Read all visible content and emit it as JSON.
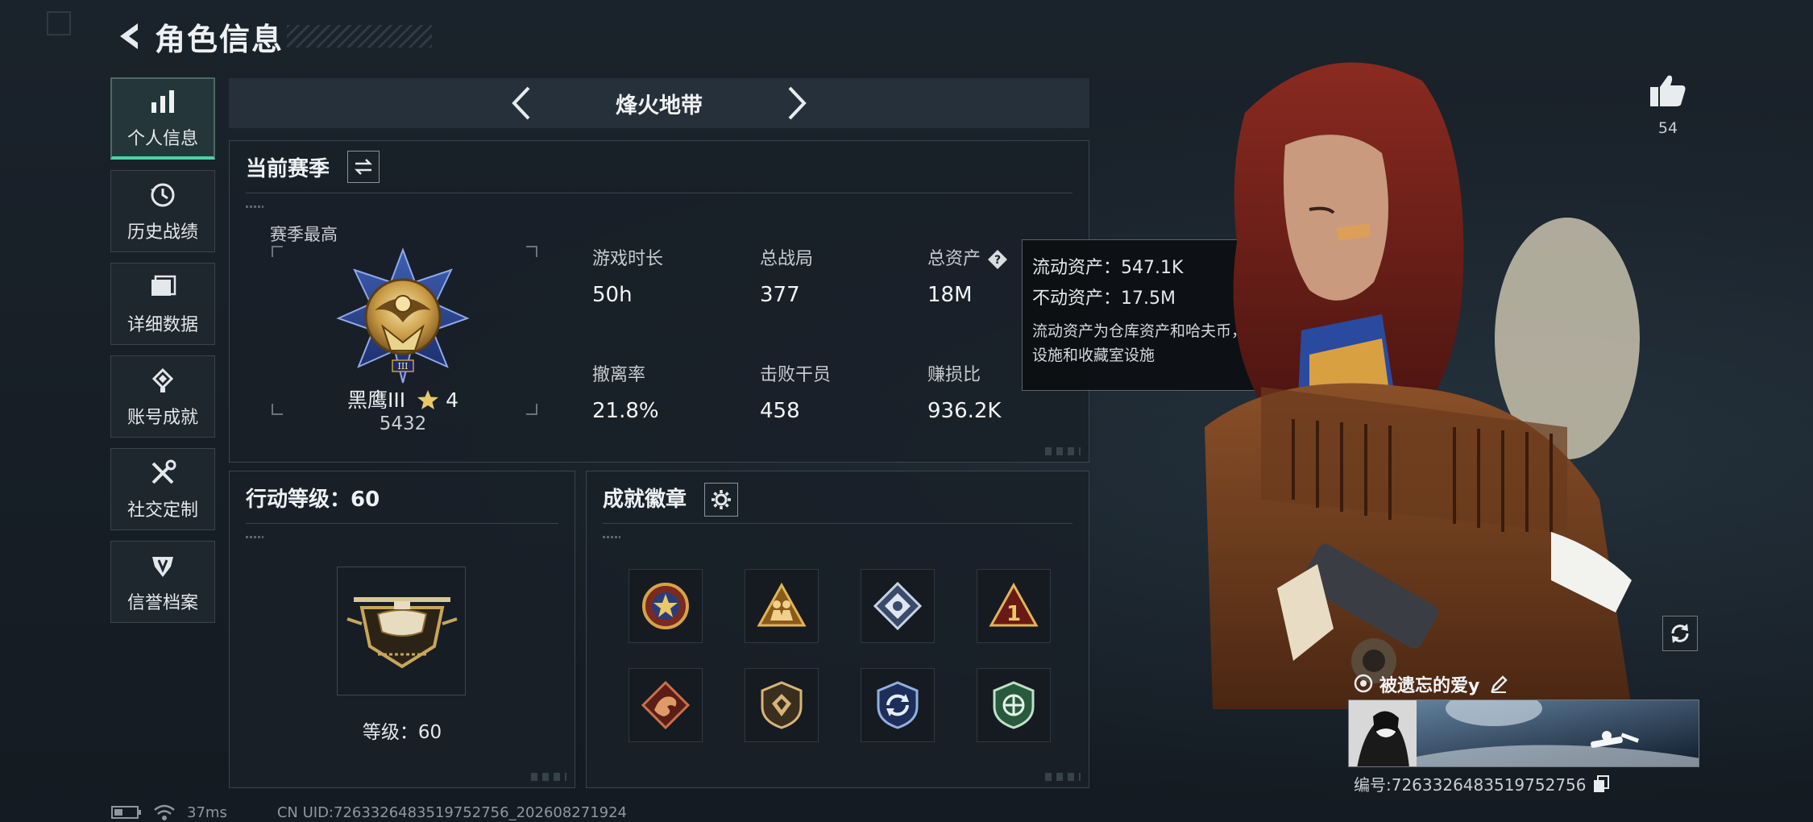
{
  "header": {
    "title": "角色信息"
  },
  "sidebar": {
    "items": [
      {
        "label": "个人信息",
        "icon": "bar-chart-icon",
        "active": true
      },
      {
        "label": "历史战绩",
        "icon": "history-icon"
      },
      {
        "label": "详细数据",
        "icon": "folder-icon"
      },
      {
        "label": "账号成就",
        "icon": "achievement-icon"
      },
      {
        "label": "社交定制",
        "icon": "tools-icon"
      },
      {
        "label": "信誉档案",
        "icon": "reputation-icon"
      }
    ]
  },
  "map": {
    "name": "烽火地带"
  },
  "season": {
    "title": "当前赛季",
    "best_label": "赛季最高",
    "rank_name": "黑鹰III",
    "rank_stars": "4",
    "rank_score": "5432",
    "stats": [
      {
        "label": "游戏时长",
        "value": "50h"
      },
      {
        "label": "总战局",
        "value": "377"
      },
      {
        "label": "总资产",
        "value": "18M",
        "has_help": true
      },
      {
        "label": "撤离率",
        "value": "21.8%"
      },
      {
        "label": "击败干员",
        "value": "458"
      },
      {
        "label": "赚损比",
        "value": "936.2K"
      }
    ]
  },
  "tooltip": {
    "liquid": "流动资产：547.1K",
    "fixed": "不动资产：17.5M",
    "desc": "流动资产为仓库资产和哈夫币，不动资产为特勤处设施和收藏室设施"
  },
  "action_level": {
    "title": "行动等级：60",
    "level_text": "等级：60"
  },
  "badges": {
    "title": "成就徽章",
    "items": [
      "star-badge-icon",
      "soldiers-badge-icon",
      "diamond-badge-icon",
      "number-one-badge-icon",
      "dragon-badge-icon",
      "shield-badge-icon",
      "cycle-badge-icon",
      "green-shield-badge-icon"
    ]
  },
  "profile": {
    "likes": "54",
    "player_name": "被遗忘的爱y",
    "player_id": "编号:7263326483519752756"
  },
  "status": {
    "ping": "37ms",
    "uid": "CN UID:7263326483519752756_202608271924"
  },
  "colors": {
    "accent": "#4fd1a5",
    "panel_border": "#3a444e",
    "background": "#161d25"
  }
}
